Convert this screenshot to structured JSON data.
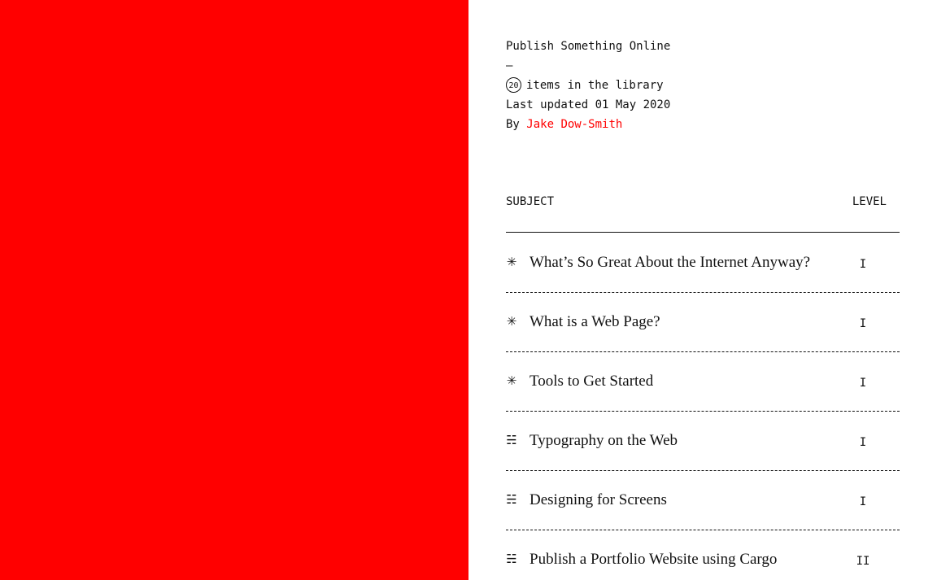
{
  "colors": {
    "accent": "#ff0000",
    "text": "#111111",
    "background": "#ffffff"
  },
  "meta": {
    "title": "Publish Something Online",
    "dash": "–",
    "item_count": "20",
    "items_label": "items in the library",
    "updated_label": "Last updated 01 May 2020",
    "by_label": "By",
    "author": "Jake Dow-Smith"
  },
  "table": {
    "header_subject": "SUBJECT",
    "header_level": "LEVEL",
    "rows": [
      {
        "icon": "asterisk-icon",
        "glyph": "✳",
        "title": "What’s So Great About the Internet Anyway?",
        "level": "I"
      },
      {
        "icon": "asterisk-icon",
        "glyph": "✳",
        "title": "What is a Web Page?",
        "level": "I"
      },
      {
        "icon": "asterisk-icon",
        "glyph": "✳",
        "title": "Tools to Get Started",
        "level": "I"
      },
      {
        "icon": "list-icon",
        "glyph": "☵",
        "title": "Typography on the Web",
        "level": "I"
      },
      {
        "icon": "list-icon",
        "glyph": "☵",
        "title": "Designing for Screens",
        "level": "I"
      },
      {
        "icon": "list-icon",
        "glyph": "☵",
        "title": "Publish a Portfolio Website using Cargo",
        "level": "II"
      }
    ]
  }
}
